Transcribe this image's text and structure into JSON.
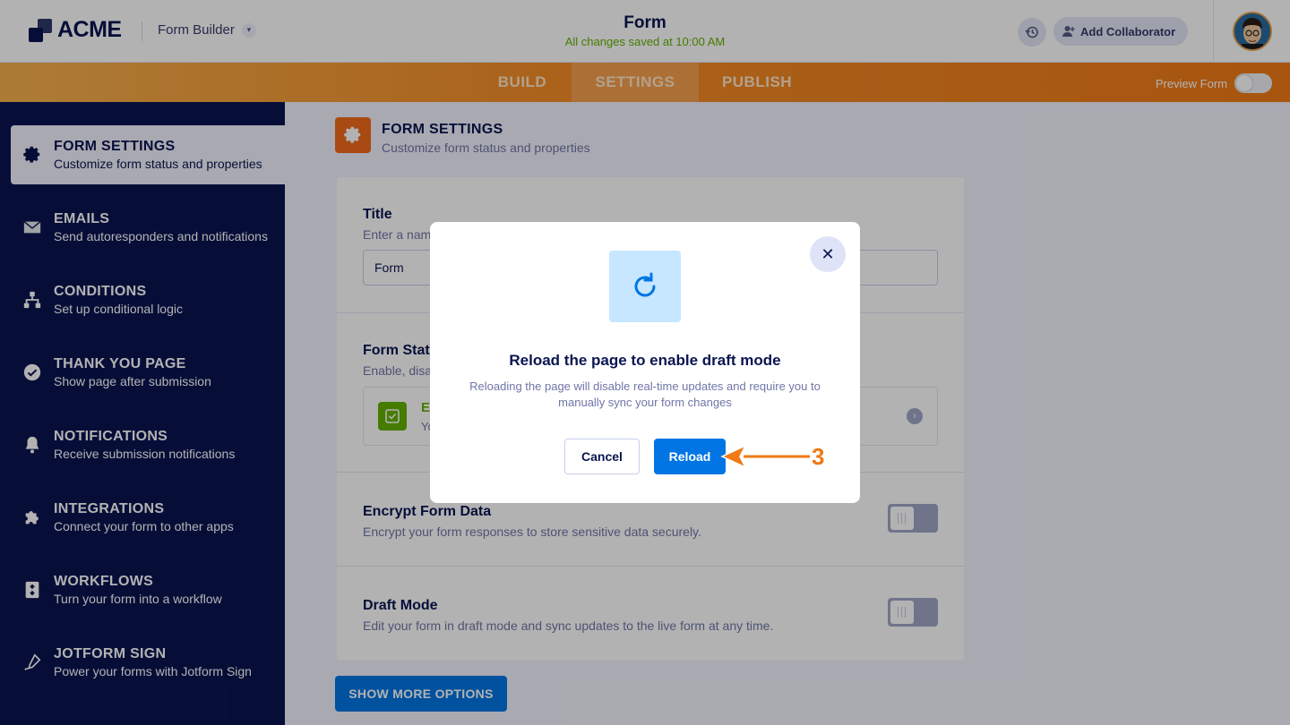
{
  "header": {
    "logo_text": "ACME",
    "builder_label": "Form Builder",
    "form_title": "Form",
    "save_status": "All changes saved at 10:00 AM",
    "add_collaborator_label": "Add Collaborator"
  },
  "nav": {
    "tabs": [
      {
        "label": "BUILD"
      },
      {
        "label": "SETTINGS",
        "active": true
      },
      {
        "label": "PUBLISH"
      }
    ],
    "preview_label": "Preview Form"
  },
  "sidebar": {
    "items": [
      {
        "title": "FORM SETTINGS",
        "subtitle": "Customize form status and properties",
        "icon": "gear-icon",
        "active": true
      },
      {
        "title": "EMAILS",
        "subtitle": "Send autoresponders and notifications",
        "icon": "envelope-icon"
      },
      {
        "title": "CONDITIONS",
        "subtitle": "Set up conditional logic",
        "icon": "hierarchy-icon"
      },
      {
        "title": "THANK YOU PAGE",
        "subtitle": "Show page after submission",
        "icon": "check-circle-icon"
      },
      {
        "title": "NOTIFICATIONS",
        "subtitle": "Receive submission notifications",
        "icon": "bell-icon"
      },
      {
        "title": "INTEGRATIONS",
        "subtitle": "Connect your form to other apps",
        "icon": "puzzle-icon"
      },
      {
        "title": "WORKFLOWS",
        "subtitle": "Turn your form into a workflow",
        "icon": "workflow-icon"
      },
      {
        "title": "JOTFORM SIGN",
        "subtitle": "Power your forms with Jotform Sign",
        "icon": "pen-icon"
      }
    ]
  },
  "main": {
    "title": "FORM SETTINGS",
    "subtitle": "Customize form status and properties",
    "title_field": {
      "label": "Title",
      "hint": "Enter a nam",
      "value": "Form"
    },
    "form_status": {
      "label": "Form Statu",
      "hint": "Enable, disa",
      "status_label": "E",
      "status_desc": "Yo"
    },
    "encrypt": {
      "label": "Encrypt Form Data",
      "desc": "Encrypt your form responses to store sensitive data securely."
    },
    "draft": {
      "label": "Draft Mode",
      "desc": "Edit your form in draft mode and sync updates to the live form at any time."
    },
    "show_more_label": "SHOW MORE OPTIONS"
  },
  "modal": {
    "title": "Reload the page to enable draft mode",
    "description": "Reloading the page will disable real-time updates and require you to manually sync your form changes",
    "cancel_label": "Cancel",
    "reload_label": "Reload",
    "close_icon": "close-icon",
    "icon": "refresh-icon"
  },
  "annotation": {
    "step": "3"
  },
  "colors": {
    "sidebar_bg": "#0a1551",
    "accent_orange": "#f07a16",
    "primary_blue": "#0075e3",
    "success_green": "#64b200"
  }
}
